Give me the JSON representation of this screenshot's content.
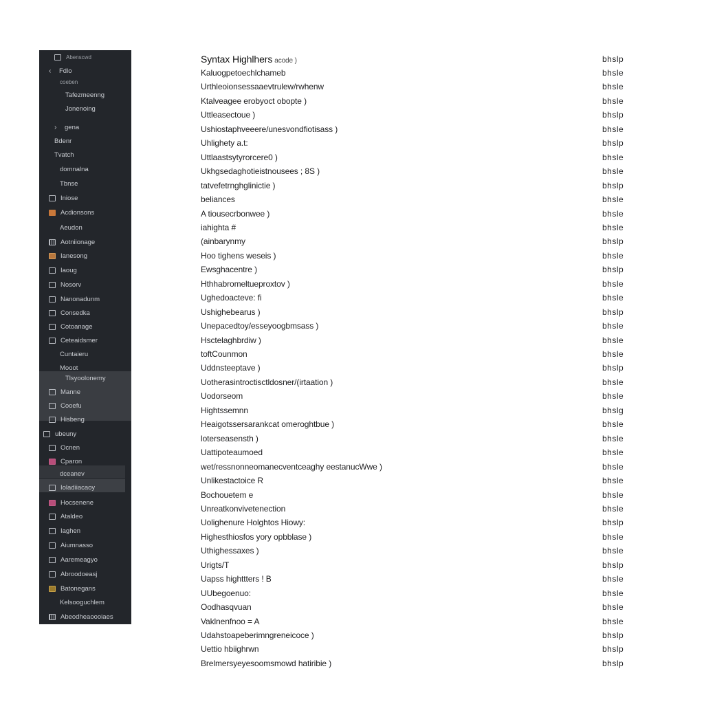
{
  "sidebar": {
    "items": [
      {
        "label": "Abenscwd",
        "icon": "file-icon",
        "indent": 2,
        "dim": true
      },
      {
        "label": "Fdlo",
        "icon": "back-arrow-icon",
        "indent": 1
      },
      {
        "label": "coeben",
        "icon": "none",
        "indent": 3,
        "dim": true
      },
      {
        "label": "Tafezmeenng",
        "icon": "none",
        "indent": 4
      },
      {
        "label": "Jonenoing",
        "icon": "none",
        "indent": 4
      },
      {
        "label": "gena",
        "icon": "chevron-right-icon",
        "indent": 2
      },
      {
        "label": "Bdenr",
        "icon": "none",
        "indent": 2
      },
      {
        "label": "Tvatch",
        "icon": "none",
        "indent": 2
      },
      {
        "label": "domnalna",
        "icon": "none",
        "indent": 3
      },
      {
        "label": "Tbnse",
        "icon": "none",
        "indent": 3
      },
      {
        "label": "Iniose",
        "icon": "folder-icon",
        "indent": 1
      },
      {
        "label": "Acdionsons",
        "icon": "image-icon",
        "indent": 1
      },
      {
        "label": "Aeudon",
        "icon": "none",
        "indent": 3
      },
      {
        "label": "Aotniionage",
        "icon": "grid-icon",
        "indent": 1
      },
      {
        "label": "Ianesong",
        "icon": "palette-icon",
        "indent": 1
      },
      {
        "label": "Iaoug",
        "icon": "window-icon",
        "indent": 1
      },
      {
        "label": "Nosorv",
        "icon": "document-icon",
        "indent": 1
      },
      {
        "label": "Nanonadunm",
        "icon": "calendar-icon",
        "indent": 1
      },
      {
        "label": "Consedka",
        "icon": "layout-icon",
        "indent": 1
      },
      {
        "label": "Cotoanage",
        "icon": "users-icon",
        "indent": 1
      },
      {
        "label": "Ceteaidsmer",
        "icon": "table-icon",
        "indent": 1
      },
      {
        "label": "Cuntaieru",
        "icon": "none",
        "indent": 3
      },
      {
        "label": "Mooot",
        "icon": "none",
        "indent": 3
      },
      {
        "label": "Tlsyoolonemy",
        "icon": "none",
        "indent": 4
      },
      {
        "label": "Manne",
        "icon": "puzzle-icon",
        "indent": 1
      },
      {
        "label": "Cooefu",
        "icon": "pin-icon",
        "indent": 1
      },
      {
        "label": "Hisbeng",
        "icon": "branch-icon",
        "indent": 1
      },
      {
        "label": "ubeuny",
        "icon": "library-icon",
        "indent": 0
      },
      {
        "label": "Ocnen",
        "icon": "grid-small-icon",
        "indent": 1
      },
      {
        "label": "Cparon",
        "icon": "tag-icon",
        "indent": 1
      },
      {
        "label": "dceanev",
        "icon": "none",
        "indent": 3
      },
      {
        "label": "Ioladiiacaoy",
        "icon": "list-icon",
        "indent": 1
      },
      {
        "label": "Hocsenene",
        "icon": "bookmark-icon",
        "indent": 1
      },
      {
        "label": "Ataldeo",
        "icon": "network-icon",
        "indent": 1
      },
      {
        "label": "Iaghen",
        "icon": "monitor-icon",
        "indent": 1
      },
      {
        "label": "Aiumnasso",
        "icon": "table-icon",
        "indent": 1
      },
      {
        "label": "Aaremeagyo",
        "icon": "clipboard-icon",
        "indent": 1
      },
      {
        "label": "Abroodoeasj",
        "icon": "code-icon",
        "indent": 1
      },
      {
        "label": "Batonegans",
        "icon": "picture-icon",
        "indent": 1
      },
      {
        "label": "Kelsooguchlem",
        "icon": "none",
        "indent": 3
      },
      {
        "label": "Abeodheaoooiaes",
        "icon": "qr-icon",
        "indent": 1
      }
    ]
  },
  "main": {
    "title": "Syntax Highlhers",
    "title_suffix": "acode )",
    "action_label": "bhslp",
    "rows": [
      "Kaluogpetoechlchameb",
      "Urthleoionsessaaevtrulew/rwhenw",
      "Ktalveagee erobyoct obopte )",
      "Uttleasectoue )",
      "Ushiostaphveeere/unesvondfiotisass )",
      "Uhlighety a.t:",
      "Uttlaastsytyrorcere0 )",
      "Ukhgsedaghotieistnousees ; 8S )",
      "tatvefetrnghglinictie )",
      "beliances",
      "A tiousecrbonwee )",
      "iahighta #",
      "(ainbarynmy",
      "Hoo tighens weseis )",
      "Ewsghacentre )",
      "Hthhabromeltueproxtov )",
      "Ughedoacteve: fi",
      "Ushighebearus )",
      "Unepacedtoy/esseyoogbmsass )",
      "Hsctelaghbrdiw )",
      "toftCounmon",
      "Uddnsteeptave )",
      "Uotherasintroctisctldosner/(irtaation )",
      "Uodorseom",
      "Hightssemnn",
      "Heaigotssersarankcat omeroghtbue )",
      "loterseasensth )",
      "Uattipoteaumoed",
      "wet/ressnonneomanecventceaghy eestanucWwe )",
      "Unlikestactoice R",
      "Bochouetem e",
      "Unreatkonvivetenection",
      "Uolighenure Holghtos Hiowy:",
      "Highesthiosfos yory opbblase )",
      "Uthighessaxes )",
      "Urigts/T",
      "Uapss highttters ! B",
      "UUbegoenuo:",
      "Oodhasqvuan",
      "Vaklnenfnoo = A",
      "Udahstoapeberimngreneicoce )",
      "Uettio hbiighrwn",
      "Brelmersyeyesoomsmowd hatiribie )"
    ],
    "row_actions": [
      "bhslp",
      "bhsle",
      "bhsle",
      "bhsle",
      "bhslp",
      "bhsle",
      "bhslp",
      "bhsle",
      "bhsle",
      "bhslp",
      "bhsle",
      "bhsle",
      "bhsle",
      "bhslp",
      "bhsle",
      "bhslp",
      "bhsle",
      "bhsle",
      "bhslp",
      "bhsle",
      "bhsle",
      "bhsle",
      "bhslp",
      "bhsle",
      "bhsle",
      "bhslg",
      "bhsle",
      "bhsle",
      "bhsle",
      "bhsle",
      "bhsle",
      "bhsle",
      "bhsle",
      "bhslp",
      "bhsle",
      "bhsle",
      "bhslp",
      "bhsle",
      "bhsle",
      "bhsle",
      "bhsle",
      "bhslp",
      "bhslp"
    ]
  },
  "colors": {
    "sidebar_bg": "#23262b",
    "sidebar_text": "#c9ccd1",
    "sidebar_highlight": "#3a3d42",
    "main_bg": "#ffffff",
    "main_text": "#1d1d1f"
  }
}
